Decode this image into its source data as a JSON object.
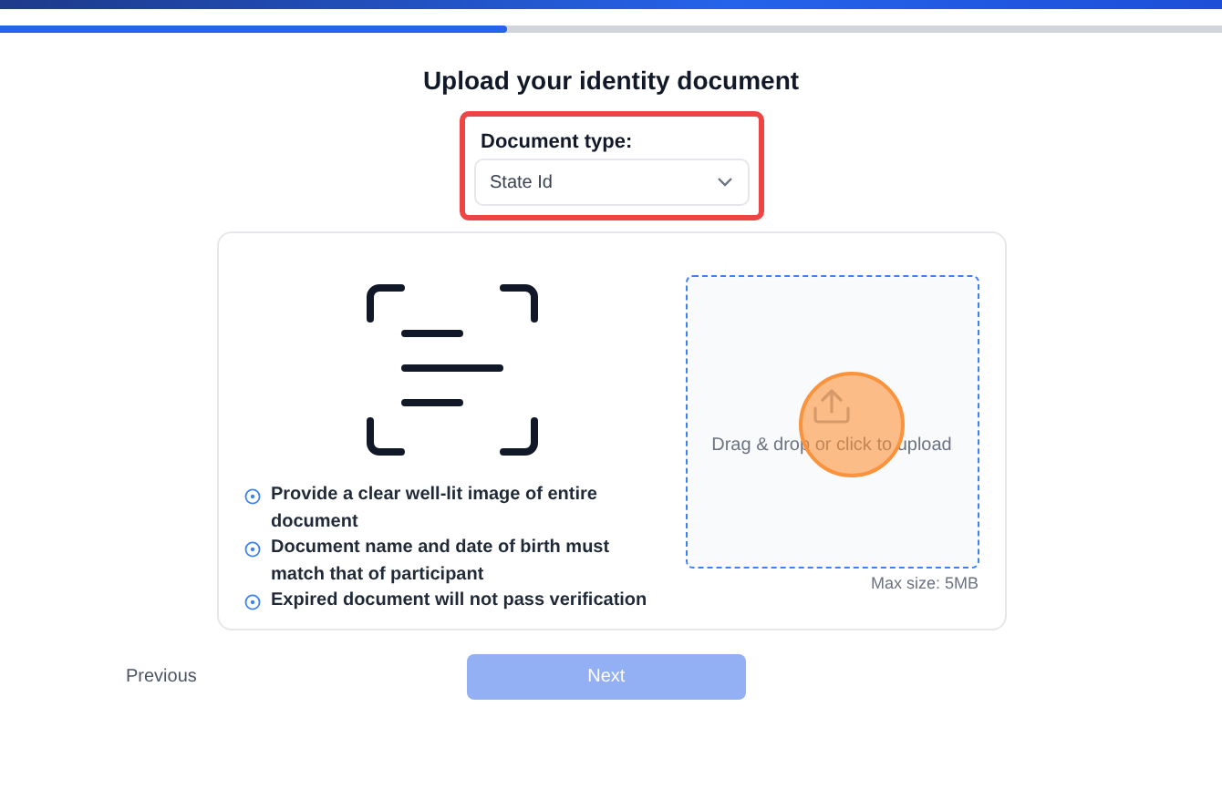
{
  "progress": {
    "level": 0.415
  },
  "title": "Upload your identity document",
  "document_type": {
    "label": "Document type:",
    "value": "State Id",
    "highlighted": true
  },
  "guidelines": [
    {
      "text": "Provide a clear well-lit image of entire document"
    },
    {
      "text": "Document name and date of birth must match that of participant"
    },
    {
      "text": "Expired document will not pass verification"
    }
  ],
  "upload": {
    "prompt": "Drag & drop or click to upload",
    "note": "Max size: 5MB",
    "click_marker": true
  },
  "buttons": {
    "previous": "Previous",
    "next": {
      "label": "Next",
      "disabled": true
    }
  }
}
